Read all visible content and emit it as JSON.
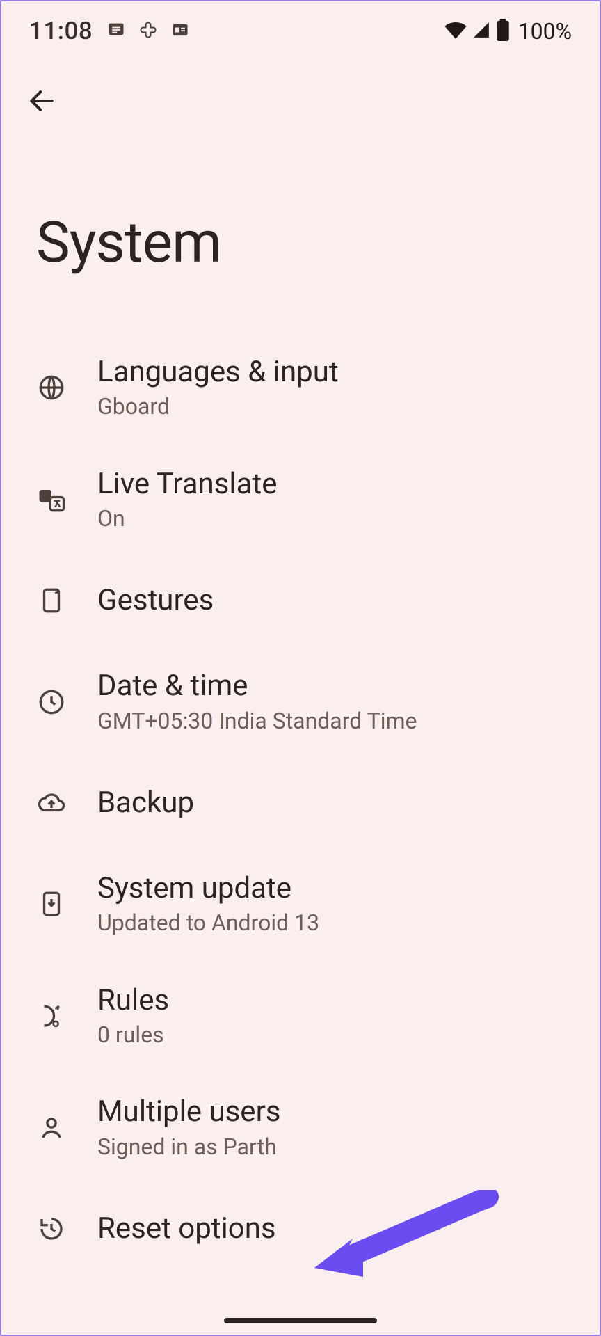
{
  "statusbar": {
    "time": "11:08",
    "battery": "100%"
  },
  "page": {
    "title": "System"
  },
  "items": [
    {
      "title": "Languages & input",
      "sub": "Gboard"
    },
    {
      "title": "Live Translate",
      "sub": "On"
    },
    {
      "title": "Gestures",
      "sub": ""
    },
    {
      "title": "Date & time",
      "sub": "GMT+05:30 India Standard Time"
    },
    {
      "title": "Backup",
      "sub": ""
    },
    {
      "title": "System update",
      "sub": "Updated to Android 13"
    },
    {
      "title": "Rules",
      "sub": "0 rules"
    },
    {
      "title": "Multiple users",
      "sub": "Signed in as Parth"
    },
    {
      "title": "Reset options",
      "sub": ""
    }
  ]
}
